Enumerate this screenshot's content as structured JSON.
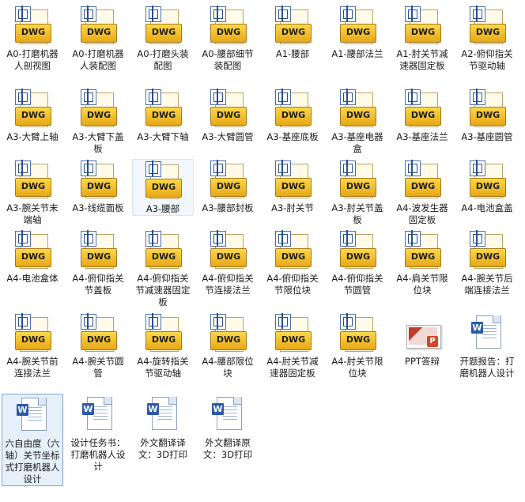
{
  "files": [
    {
      "name": "A0-打磨机器人剖视图",
      "type": "dwg"
    },
    {
      "name": "A0-打磨机器人装配图",
      "type": "dwg"
    },
    {
      "name": "A0-打磨头装配图",
      "type": "dwg"
    },
    {
      "name": "A0-腰部细节装配图",
      "type": "dwg"
    },
    {
      "name": "A1-腰部",
      "type": "dwg"
    },
    {
      "name": "A1-腰部法兰",
      "type": "dwg"
    },
    {
      "name": "A1-肘关节减速器固定板",
      "type": "dwg"
    },
    {
      "name": "A2-俯仰指关节驱动轴",
      "type": "dwg"
    },
    {
      "name": "A3-大臂上轴",
      "type": "dwg"
    },
    {
      "name": "A3-大臂下盖板",
      "type": "dwg"
    },
    {
      "name": "A3-大臂下轴",
      "type": "dwg"
    },
    {
      "name": "A3-大臂圆管",
      "type": "dwg"
    },
    {
      "name": "A3-基座底板",
      "type": "dwg"
    },
    {
      "name": "A3-基座电器盒",
      "type": "dwg"
    },
    {
      "name": "A3-基座法兰",
      "type": "dwg"
    },
    {
      "name": "A3-基座圆管",
      "type": "dwg"
    },
    {
      "name": "A3-腕关节末端轴",
      "type": "dwg"
    },
    {
      "name": "A3-线缆面板",
      "type": "dwg"
    },
    {
      "name": "A3-腰部",
      "type": "dwg",
      "selected": "soft"
    },
    {
      "name": "A3-腰部封板",
      "type": "dwg"
    },
    {
      "name": "A3-肘关节",
      "type": "dwg"
    },
    {
      "name": "A3-肘关节盖板",
      "type": "dwg"
    },
    {
      "name": "A4-波发生器固定板",
      "type": "dwg"
    },
    {
      "name": "A4-电池盒盖",
      "type": "dwg"
    },
    {
      "name": "A4-电池盒体",
      "type": "dwg"
    },
    {
      "name": "A4-俯仰指关节盖板",
      "type": "dwg"
    },
    {
      "name": "A4-俯仰指关节减速器固定板",
      "type": "dwg"
    },
    {
      "name": "A4-俯仰指关节连接法兰",
      "type": "dwg"
    },
    {
      "name": "A4-俯仰指关节限位块",
      "type": "dwg"
    },
    {
      "name": "A4-俯仰指关节圆管",
      "type": "dwg"
    },
    {
      "name": "A4-肩关节限位块",
      "type": "dwg"
    },
    {
      "name": "A4-腕关节后端连接法兰",
      "type": "dwg"
    },
    {
      "name": "A4-腕关节前连接法兰",
      "type": "dwg"
    },
    {
      "name": "A4-腕关节圆管",
      "type": "dwg"
    },
    {
      "name": "A4-旋转指关节驱动轴",
      "type": "dwg"
    },
    {
      "name": "A4-腰部限位块",
      "type": "dwg"
    },
    {
      "name": "A4-肘关节减速器固定板",
      "type": "dwg"
    },
    {
      "name": "A4-肘关节限位块",
      "type": "dwg"
    },
    {
      "name": "PPT答辩",
      "type": "ppt"
    },
    {
      "name": "开题报告：打磨机器人设计",
      "type": "doc"
    },
    {
      "name": "六自由度（六轴）关节坐标式打磨机器人设计",
      "type": "doc",
      "selected": "strong"
    },
    {
      "name": "设计任务书：打磨机器人设计",
      "type": "doc"
    },
    {
      "name": "外文翻译译文：3D打印",
      "type": "doc"
    },
    {
      "name": "外文翻译原文：3D打印",
      "type": "doc"
    }
  ],
  "icon_names": {
    "dwg": "dwg-file-icon",
    "doc": "word-document-icon",
    "ppt": "powerpoint-file-icon"
  },
  "icon_glyphs": {
    "dwg": "DWG",
    "doc": "W",
    "ppt": "P"
  }
}
